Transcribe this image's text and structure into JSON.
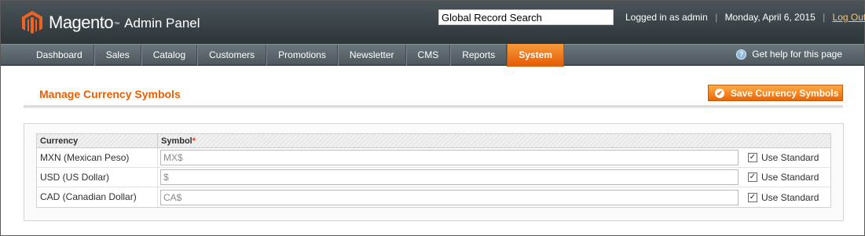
{
  "header": {
    "logo_text": "Magento",
    "logo_tm": "™",
    "logo_subtitle": "Admin Panel",
    "logo_icon": "magento-logo-icon",
    "search_value": "Global Record Search",
    "logged_in_text": "Logged in as admin",
    "date_text": "Monday, April 6, 2015",
    "logout_label": "Log Out",
    "separator": "|"
  },
  "nav": {
    "items": [
      {
        "label": "Dashboard"
      },
      {
        "label": "Sales"
      },
      {
        "label": "Catalog"
      },
      {
        "label": "Customers"
      },
      {
        "label": "Promotions"
      },
      {
        "label": "Newsletter"
      },
      {
        "label": "CMS"
      },
      {
        "label": "Reports"
      },
      {
        "label": "System",
        "active": true
      }
    ],
    "help_label": "Get help for this page",
    "help_icon_glyph": "?"
  },
  "page": {
    "title": "Manage Currency Symbols",
    "save_button_label": "Save Currency Symbols",
    "save_icon_glyph": "✔"
  },
  "grid": {
    "headers": {
      "currency": "Currency",
      "symbol": "Symbol",
      "required_mark": "*"
    },
    "rows": [
      {
        "currency": "MXN (Mexican Peso)",
        "symbol": "MX$",
        "use_standard_label": "Use Standard",
        "use_standard": true
      },
      {
        "currency": "USD (US Dollar)",
        "symbol": "$",
        "use_standard_label": "Use Standard",
        "use_standard": true
      },
      {
        "currency": "CAD (Canadian Dollar)",
        "symbol": "CA$",
        "use_standard_label": "Use Standard",
        "use_standard": true
      }
    ],
    "check_glyph": "✓"
  },
  "colors": {
    "header_bg": "#2d3539",
    "nav_bg": "#5a666c",
    "accent_orange": "#eb5e00",
    "title_orange": "#eb5e00"
  }
}
